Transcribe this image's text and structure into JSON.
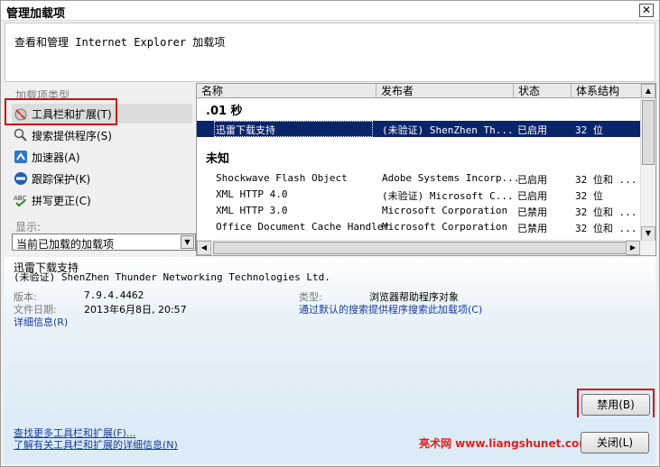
{
  "window": {
    "title": "管理加载项",
    "close_glyph": "✕"
  },
  "header": {
    "description": "查看和管理 Internet Explorer 加载项"
  },
  "sidebar": {
    "title": "加载项类型",
    "items": [
      {
        "label": "工具栏和扩展(T)",
        "icon": "toolbar-gear-icon",
        "selected": true
      },
      {
        "label": "搜索提供程序(S)",
        "icon": "search-icon"
      },
      {
        "label": "加速器(A)",
        "icon": "accelerator-icon"
      },
      {
        "label": "跟踪保护(K)",
        "icon": "no-entry-icon"
      },
      {
        "label": "拼写更正(C)",
        "icon": "spell-check-icon"
      }
    ],
    "show_label": "显示:",
    "show_value": "当前已加载的加载项"
  },
  "list": {
    "columns": [
      "名称",
      "发布者",
      "状态",
      "体系结构"
    ],
    "groups": [
      {
        "title": ".01 秒"
      },
      {
        "title": "未知"
      }
    ],
    "rows": [
      {
        "name": "迅雷下载支持",
        "publisher": "(未验证) ShenZhen Th...",
        "status": "已启用",
        "arch": "32 位"
      },
      {
        "name": "Shockwave Flash Object",
        "publisher": "Adobe Systems Incorp...",
        "status": "已启用",
        "arch": "32 位和 ..."
      },
      {
        "name": "XML HTTP 4.0",
        "publisher": "(未验证) Microsoft C...",
        "status": "已启用",
        "arch": "32 位"
      },
      {
        "name": "XML HTTP 3.0",
        "publisher": "Microsoft Corporation",
        "status": "已禁用",
        "arch": "32 位和 ..."
      },
      {
        "name": "Office Document Cache Handler",
        "publisher": "Microsoft Corporation",
        "status": "已禁用",
        "arch": "32 位和 ..."
      }
    ]
  },
  "details": {
    "name": "迅雷下载支持",
    "publisher": "(未验证) ShenZhen Thunder Networking Technologies Ltd.",
    "version_label": "版本:",
    "version": "7.9.4.4462",
    "date_label": "文件日期:",
    "date": "2013年6月8日, 20:57",
    "more_info": "详细信息(R)",
    "type_label": "类型:",
    "type": "浏览器帮助程序对象",
    "search_link": "通过默认的搜索提供程序搜索此加载项(C)",
    "disable_button": "禁用(B)"
  },
  "footer": {
    "link1": "查找更多工具栏和扩展(F)...",
    "link2": "了解有关工具栏和扩展的详细信息(N)",
    "watermark": "亮术网 www.liangshunet.com",
    "close_button": "关闭(L)"
  }
}
